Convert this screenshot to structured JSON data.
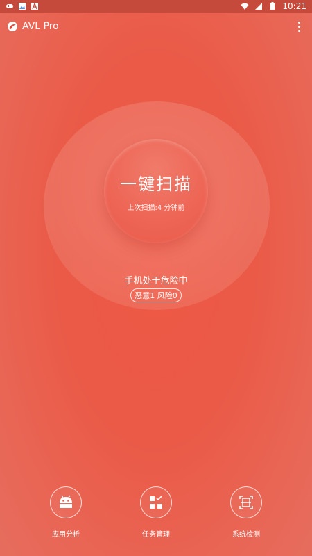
{
  "status_bar": {
    "time": "10:21",
    "left_icons": [
      "gamepad-icon",
      "image-icon",
      "a-icon"
    ],
    "right_icons": [
      "wifi-icon",
      "signal-icon",
      "battery-icon"
    ]
  },
  "app_bar": {
    "title": "AVL Pro",
    "logo_icon": "avl-logo-icon",
    "menu_icon": "more-vert-icon"
  },
  "scan": {
    "title": "一键扫描",
    "last_scan": "上次扫描:4 分钟前"
  },
  "status": {
    "message": "手机处于危险中",
    "badge": "恶意1  风险0"
  },
  "bottom_nav": [
    {
      "label": "应用分析",
      "icon": "android-icon"
    },
    {
      "label": "任务管理",
      "icon": "task-grid-icon"
    },
    {
      "label": "系统检测",
      "icon": "system-scan-icon"
    }
  ],
  "colors": {
    "background": "#ea5a47",
    "status_bar": "#c64a3b",
    "text": "#ffffff"
  }
}
